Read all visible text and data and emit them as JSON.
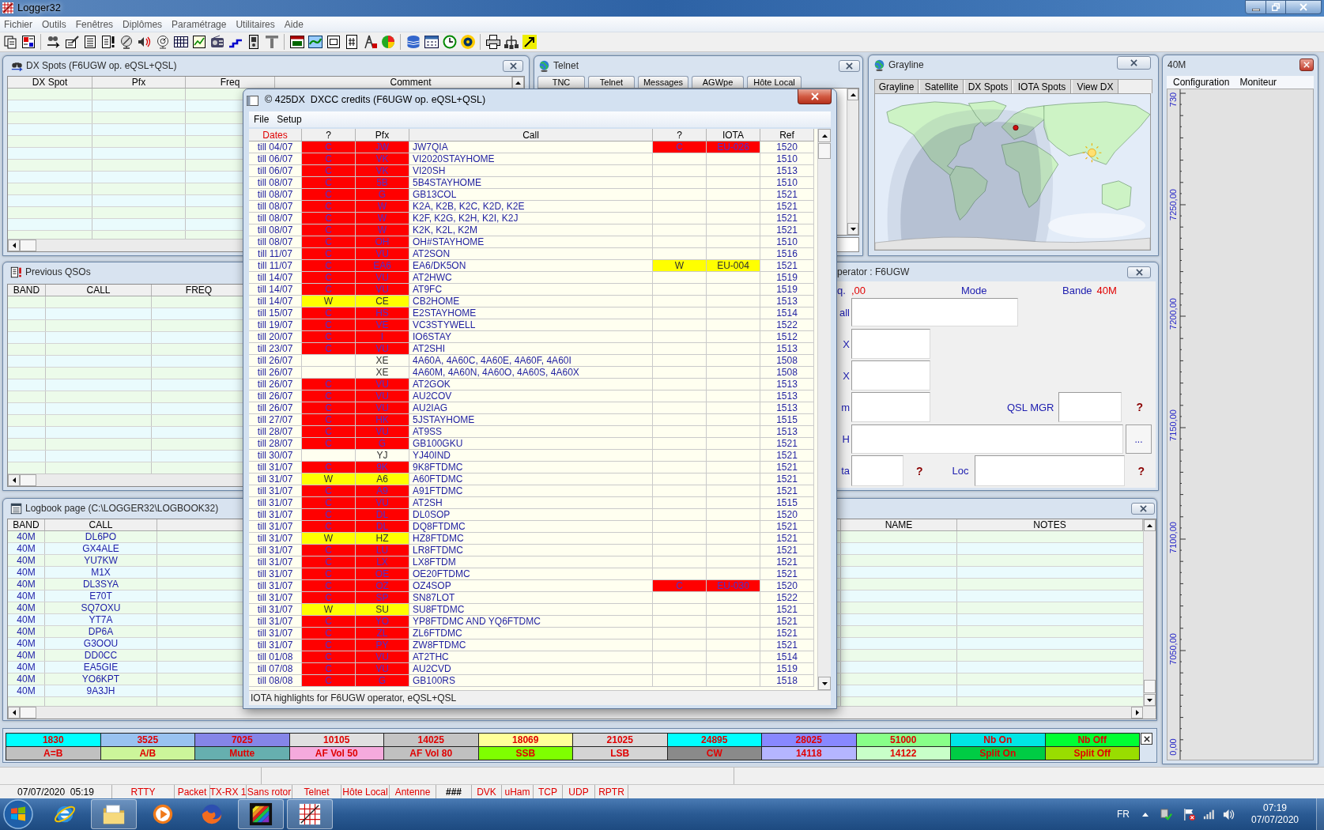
{
  "app_window": {
    "title": "Logger32"
  },
  "menu": [
    "Fichier",
    "Outils",
    "Fenêtres",
    "Diplômes",
    "Paramétrage",
    "Utilitaires",
    "Aide"
  ],
  "dx_spots": {
    "title": "DX Spots (F6UGW op. eQSL+QSL)",
    "columns": [
      "DX Spot",
      "Pfx",
      "Freq",
      "Comment"
    ]
  },
  "telnet": {
    "title": "Telnet",
    "tabs": [
      "TNC",
      "Telnet",
      "Messages",
      "AGWpe",
      "Hôte Local"
    ]
  },
  "grayline": {
    "title": "Grayline",
    "tabs": [
      "Grayline",
      "Satellite",
      "DX Spots",
      "IOTA Spots",
      "View DX"
    ]
  },
  "bandmap": {
    "title": "40M",
    "menu": [
      "Configuration",
      "Moniteur"
    ],
    "scale_labels": [
      "730",
      "7250,00",
      "7200,00",
      "7150,00",
      "7100,00",
      "7050,00",
      "0,00"
    ]
  },
  "dialog": {
    "title": "© 425DX  DXCC credits (F6UGW op. eQSL+QSL)",
    "menu": [
      "File",
      "Setup"
    ],
    "columns": [
      {
        "label": "Dates",
        "sorted": true
      },
      {
        "label": "?",
        "sorted": false
      },
      {
        "label": "Pfx",
        "sorted": false
      },
      {
        "label": "Call",
        "sorted": false
      },
      {
        "label": "?",
        "sorted": false
      },
      {
        "label": "IOTA",
        "sorted": false
      },
      {
        "label": "Ref",
        "sorted": false
      }
    ],
    "rows": [
      {
        "date": "till 04/07",
        "dxcc": {
          "flag": "C",
          "prefix": "JW",
          "color": "#ff0000"
        },
        "call": "JW7QIA",
        "iota": {
          "flag": "C",
          "code": "EU-026",
          "color": "#ff0000"
        },
        "ref": "1520"
      },
      {
        "date": "till 06/07",
        "dxcc": {
          "flag": "C",
          "prefix": "VK",
          "color": "#ff0000"
        },
        "call": "VI2020STAYHOME",
        "ref": "1510"
      },
      {
        "date": "till 06/07",
        "dxcc": {
          "flag": "C",
          "prefix": "VK",
          "color": "#ff0000"
        },
        "call": "VI20SH",
        "ref": "1513"
      },
      {
        "date": "till 08/07",
        "dxcc": {
          "flag": "C",
          "prefix": "5B",
          "color": "#ff0000"
        },
        "call": "5B4STAYHOME",
        "ref": "1510"
      },
      {
        "date": "till 08/07",
        "dxcc": {
          "flag": "C",
          "prefix": "G",
          "color": "#ff0000"
        },
        "call": "GB13COL",
        "ref": "1521"
      },
      {
        "date": "till 08/07",
        "dxcc": {
          "flag": "C",
          "prefix": "W",
          "color": "#ff0000"
        },
        "call": "K2A, K2B, K2C, K2D, K2E",
        "ref": "1521"
      },
      {
        "date": "till 08/07",
        "dxcc": {
          "flag": "C",
          "prefix": "W",
          "color": "#ff0000"
        },
        "call": "K2F, K2G, K2H, K2I, K2J",
        "ref": "1521"
      },
      {
        "date": "till 08/07",
        "dxcc": {
          "flag": "C",
          "prefix": "W",
          "color": "#ff0000"
        },
        "call": "K2K, K2L, K2M",
        "ref": "1521"
      },
      {
        "date": "till 08/07",
        "dxcc": {
          "flag": "C",
          "prefix": "OH",
          "color": "#ff0000"
        },
        "call": "OH#STAYHOME",
        "ref": "1510"
      },
      {
        "date": "till 11/07",
        "dxcc": {
          "flag": "C",
          "prefix": "VU",
          "color": "#ff0000"
        },
        "call": "AT2SON",
        "ref": "1516"
      },
      {
        "date": "till 11/07",
        "dxcc": {
          "flag": "C",
          "prefix": "EA6",
          "color": "#ff0000"
        },
        "call": "EA6/DK5ON",
        "iota": {
          "flag": "W",
          "code": "EU-004",
          "color": "#ffff00"
        },
        "ref": "1521"
      },
      {
        "date": "till 14/07",
        "dxcc": {
          "flag": "C",
          "prefix": "VU",
          "color": "#ff0000"
        },
        "call": "AT2HWC",
        "ref": "1519"
      },
      {
        "date": "till 14/07",
        "dxcc": {
          "flag": "C",
          "prefix": "VU",
          "color": "#ff0000"
        },
        "call": "AT9FC",
        "ref": "1519"
      },
      {
        "date": "till 14/07",
        "dxcc": {
          "flag": "W",
          "prefix": "CE",
          "color": "#ffff00"
        },
        "call": "CB2HOME",
        "ref": "1513"
      },
      {
        "date": "till 15/07",
        "dxcc": {
          "flag": "C",
          "prefix": "HS",
          "color": "#ff0000"
        },
        "call": "E2STAYHOME",
        "ref": "1514"
      },
      {
        "date": "till 19/07",
        "dxcc": {
          "flag": "C",
          "prefix": "VE",
          "color": "#ff0000"
        },
        "call": "VC3STYWELL",
        "ref": "1522"
      },
      {
        "date": "till 20/07",
        "dxcc": {
          "flag": "C",
          "prefix": "I",
          "color": "#ff0000"
        },
        "call": "IO6STAY",
        "ref": "1512"
      },
      {
        "date": "till 23/07",
        "dxcc": {
          "flag": "C",
          "prefix": "VU",
          "color": "#ff0000"
        },
        "call": "AT2SHI",
        "ref": "1513"
      },
      {
        "date": "till 26/07",
        "dxcc": {
          "prefix": "XE"
        },
        "call": "4A60A, 4A60C, 4A60E, 4A60F, 4A60I",
        "ref": "1508"
      },
      {
        "date": "till 26/07",
        "dxcc": {
          "prefix": "XE"
        },
        "call": "4A60M, 4A60N, 4A60O, 4A60S, 4A60X",
        "ref": "1508"
      },
      {
        "date": "till 26/07",
        "dxcc": {
          "flag": "C",
          "prefix": "VU",
          "color": "#ff0000"
        },
        "call": "AT2GOK",
        "ref": "1513"
      },
      {
        "date": "till 26/07",
        "dxcc": {
          "flag": "C",
          "prefix": "VU",
          "color": "#ff0000"
        },
        "call": "AU2COV",
        "ref": "1513"
      },
      {
        "date": "till 26/07",
        "dxcc": {
          "flag": "C",
          "prefix": "VU",
          "color": "#ff0000"
        },
        "call": "AU2IAG",
        "ref": "1513"
      },
      {
        "date": "till 27/07",
        "dxcc": {
          "flag": "C",
          "prefix": "HK",
          "color": "#ff0000"
        },
        "call": "5JSTAYHOME",
        "ref": "1515"
      },
      {
        "date": "till 28/07",
        "dxcc": {
          "flag": "C",
          "prefix": "VU",
          "color": "#ff0000"
        },
        "call": "AT9SS",
        "ref": "1513"
      },
      {
        "date": "till 28/07",
        "dxcc": {
          "flag": "C",
          "prefix": "G",
          "color": "#ff0000"
        },
        "call": "GB100GKU",
        "ref": "1521"
      },
      {
        "date": "till 30/07",
        "dxcc": {
          "prefix": "YJ"
        },
        "call": "YJ40IND",
        "ref": "1521"
      },
      {
        "date": "till 31/07",
        "dxcc": {
          "flag": "C",
          "prefix": "9K",
          "color": "#ff0000"
        },
        "call": "9K8FTDMC",
        "ref": "1521"
      },
      {
        "date": "till 31/07",
        "dxcc": {
          "flag": "W",
          "prefix": "A6",
          "color": "#ffff00"
        },
        "call": "A60FTDMC",
        "ref": "1521"
      },
      {
        "date": "till 31/07",
        "dxcc": {
          "flag": "C",
          "prefix": "A9",
          "color": "#ff0000"
        },
        "call": "A91FTDMC",
        "ref": "1521"
      },
      {
        "date": "till 31/07",
        "dxcc": {
          "flag": "C",
          "prefix": "VU",
          "color": "#ff0000"
        },
        "call": "AT2SH",
        "ref": "1515"
      },
      {
        "date": "till 31/07",
        "dxcc": {
          "flag": "C",
          "prefix": "DL",
          "color": "#ff0000"
        },
        "call": "DL0SOP",
        "ref": "1520"
      },
      {
        "date": "till 31/07",
        "dxcc": {
          "flag": "C",
          "prefix": "DL",
          "color": "#ff0000"
        },
        "call": "DQ8FTDMC",
        "ref": "1521"
      },
      {
        "date": "till 31/07",
        "dxcc": {
          "flag": "W",
          "prefix": "HZ",
          "color": "#ffff00"
        },
        "call": "HZ8FTDMC",
        "ref": "1521"
      },
      {
        "date": "till 31/07",
        "dxcc": {
          "flag": "C",
          "prefix": "LU",
          "color": "#ff0000"
        },
        "call": "LR8FTDMC",
        "ref": "1521"
      },
      {
        "date": "till 31/07",
        "dxcc": {
          "flag": "C",
          "prefix": "LX",
          "color": "#ff0000"
        },
        "call": "LX8FTDM",
        "ref": "1521"
      },
      {
        "date": "till 31/07",
        "dxcc": {
          "flag": "C",
          "prefix": "OE",
          "color": "#ff0000"
        },
        "call": "OE20FTDMC",
        "ref": "1521"
      },
      {
        "date": "till 31/07",
        "dxcc": {
          "flag": "C",
          "prefix": "OZ",
          "color": "#ff0000"
        },
        "call": "OZ4SOP",
        "iota": {
          "flag": "C",
          "code": "EU-030",
          "color": "#ff0000"
        },
        "ref": "1520"
      },
      {
        "date": "till 31/07",
        "dxcc": {
          "flag": "C",
          "prefix": "SP",
          "color": "#ff0000"
        },
        "call": "SN87LOT",
        "ref": "1522"
      },
      {
        "date": "till 31/07",
        "dxcc": {
          "flag": "W",
          "prefix": "SU",
          "color": "#ffff00"
        },
        "call": "SU8FTDMC",
        "ref": "1521"
      },
      {
        "date": "till 31/07",
        "dxcc": {
          "flag": "C",
          "prefix": "YO",
          "color": "#ff0000"
        },
        "call": "YP8FTDMC AND YQ6FTDMC",
        "ref": "1521"
      },
      {
        "date": "till 31/07",
        "dxcc": {
          "flag": "C",
          "prefix": "ZL",
          "color": "#ff0000"
        },
        "call": "ZL6FTDMC",
        "ref": "1521"
      },
      {
        "date": "till 31/07",
        "dxcc": {
          "flag": "C",
          "prefix": "PY",
          "color": "#ff0000"
        },
        "call": "ZW8FTDMC",
        "ref": "1521"
      },
      {
        "date": "till 01/08",
        "dxcc": {
          "flag": "C",
          "prefix": "VU",
          "color": "#ff0000"
        },
        "call": "AT2THC",
        "ref": "1514"
      },
      {
        "date": "till 07/08",
        "dxcc": {
          "flag": "C",
          "prefix": "VU",
          "color": "#ff0000"
        },
        "call": "AU2CVD",
        "ref": "1519"
      },
      {
        "date": "till 08/08",
        "dxcc": {
          "flag": "C",
          "prefix": "G",
          "color": "#ff0000"
        },
        "call": "GB100RS",
        "ref": "1518"
      }
    ],
    "status": "IOTA highlights for F6UGW operator, eQSL+QSL"
  },
  "previous_qsos": {
    "title": "Previous QSOs",
    "columns": [
      "BAND",
      "CALL",
      "FREQ"
    ]
  },
  "operator": {
    "title": "perator : F6UGW",
    "freq_label": "q.",
    "freq_value": ",00",
    "mode_label": "Mode",
    "band_label": "Bande",
    "band_value": "40M",
    "call_label": "all",
    "tx_label": "X",
    "rx_label": "X",
    "row4_label": "m",
    "qsl_mgr_label": "QSL MGR",
    "qth_label": "H",
    "row6_label": "ta",
    "loc_label": "Loc",
    "help_buttons": [
      "?",
      "?",
      "?"
    ],
    "browse_button": "..."
  },
  "logbook": {
    "title": "Logbook page (C:\\LOGGER32\\LOGBOOK32)",
    "left_columns": [
      "BAND",
      "CALL"
    ],
    "right_columns": [
      "NAME",
      "NOTES"
    ],
    "rows": [
      {
        "band": "40M",
        "call": "DL6PO"
      },
      {
        "band": "40M",
        "call": "GX4ALE"
      },
      {
        "band": "40M",
        "call": "YU7KW"
      },
      {
        "band": "40M",
        "call": "M1X"
      },
      {
        "band": "40M",
        "call": "DL3SYA"
      },
      {
        "band": "40M",
        "call": "E70T"
      },
      {
        "band": "40M",
        "call": "SQ7OXU"
      },
      {
        "band": "40M",
        "call": "YT7A"
      },
      {
        "band": "40M",
        "call": "DP6A"
      },
      {
        "band": "40M",
        "call": "G3OOU"
      },
      {
        "band": "40M",
        "call": "DD0CC"
      },
      {
        "band": "40M",
        "call": "EA5GIE"
      },
      {
        "band": "40M",
        "call": "YO6KPT"
      },
      {
        "band": "40M",
        "call": "9A3JH"
      }
    ]
  },
  "band_bar": {
    "rows": [
      [
        {
          "label": "1830",
          "color": "#00ffff"
        },
        {
          "label": "3525",
          "color": "#99c2f0"
        },
        {
          "label": "7025",
          "color": "#8585e8"
        },
        {
          "label": "10105",
          "color": "#e0e0e0"
        },
        {
          "label": "14025",
          "color": "#c4c4c4"
        },
        {
          "label": "18069",
          "color": "#ffff99"
        },
        {
          "label": "21025",
          "color": "#dadada"
        },
        {
          "label": "24895",
          "color": "#00ffff"
        },
        {
          "label": "28025",
          "color": "#8888ff"
        },
        {
          "label": "51000",
          "color": "#88ff88"
        },
        {
          "label": "Nb On",
          "color": "#00e6e6"
        },
        {
          "label": "Nb Off",
          "color": "#00ff33"
        }
      ],
      [
        {
          "label": "A=B",
          "color": "#c0c0c0"
        },
        {
          "label": "A/B",
          "color": "#ccf59a"
        },
        {
          "label": "Mutte",
          "color": "#66afaf"
        },
        {
          "label": "AF Vol 50",
          "color": "#f5aadd"
        },
        {
          "label": "AF Vol 80",
          "color": "#c0c0c0"
        },
        {
          "label": "SSB",
          "color": "#7fff00"
        },
        {
          "label": "LSB",
          "color": "#d4d4d4"
        },
        {
          "label": "CW",
          "color": "#8a8a8a"
        },
        {
          "label": "14118",
          "color": "#b5b5ff"
        },
        {
          "label": "14122",
          "color": "#c8ffc8"
        },
        {
          "label": "Split On",
          "color": "#00cc44"
        },
        {
          "label": "Split Off",
          "color": "#99dd00"
        }
      ]
    ]
  },
  "status_bar": [
    {
      "text": "07/07/2020  05:19",
      "color": "#000000"
    },
    {
      "text": "RTTY",
      "color": "#e00000"
    },
    {
      "text": "Packet",
      "color": "#e00000"
    },
    {
      "text": "TX-RX 1",
      "color": "#e00000"
    },
    {
      "text": "Sans rotor",
      "color": "#e00000"
    },
    {
      "text": "Telnet",
      "color": "#e00000"
    },
    {
      "text": "Hôte Local",
      "color": "#e00000"
    },
    {
      "text": "Antenne",
      "color": "#e00000"
    },
    {
      "text": "###",
      "color": "#000000",
      "bold": true
    },
    {
      "text": "DVK",
      "color": "#e00000"
    },
    {
      "text": "uHam",
      "color": "#e00000"
    },
    {
      "text": "TCP",
      "color": "#e00000"
    },
    {
      "text": "UDP",
      "color": "#e00000"
    },
    {
      "text": "RPTR",
      "color": "#e00000"
    }
  ],
  "taskbar": {
    "apps": [
      {
        "kind": "ringed",
        "running": false
      },
      {
        "kind": "folder",
        "running": true
      },
      {
        "kind": "player",
        "running": false
      },
      {
        "kind": "globe",
        "running": false
      },
      {
        "kind": "film",
        "running": true
      },
      {
        "kind": "grid",
        "running": true
      }
    ],
    "language": "FR",
    "time": "07:19",
    "date": "07/07/2020"
  }
}
